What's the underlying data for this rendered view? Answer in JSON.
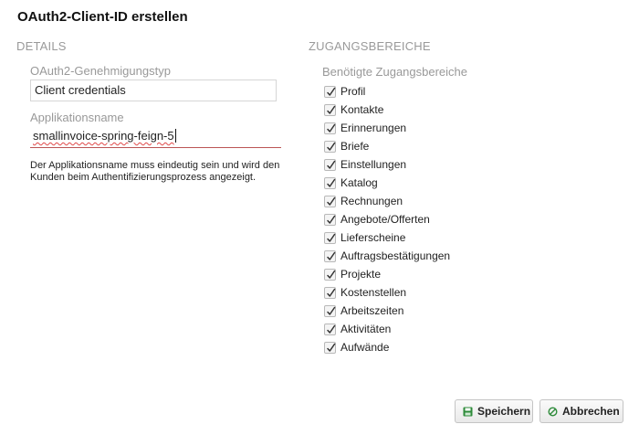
{
  "dialog": {
    "title": "OAuth2-Client-ID erstellen"
  },
  "details": {
    "heading": "DETAILS",
    "grant_type_label": "OAuth2-Genehmigungstyp",
    "grant_type_value": "Client credentials",
    "app_name_label": "Applikationsname",
    "app_name_value": "smallinvoice-spring-feign-5",
    "help_text": "Der Applikationsname muss eindeutig sein und wird den Kunden beim Authentifizierungsprozess angezeigt."
  },
  "scopes": {
    "heading": "ZUGANGSBEREICHE",
    "required_label": "Benötigte Zugangsbereiche",
    "items": [
      {
        "label": "Profil",
        "checked": true
      },
      {
        "label": "Kontakte",
        "checked": true
      },
      {
        "label": "Erinnerungen",
        "checked": true
      },
      {
        "label": "Briefe",
        "checked": true
      },
      {
        "label": "Einstellungen",
        "checked": true
      },
      {
        "label": "Katalog",
        "checked": true
      },
      {
        "label": "Rechnungen",
        "checked": true
      },
      {
        "label": "Angebote/Offerten",
        "checked": true
      },
      {
        "label": "Lieferscheine",
        "checked": true
      },
      {
        "label": "Auftragsbestätigungen",
        "checked": true
      },
      {
        "label": "Projekte",
        "checked": true
      },
      {
        "label": "Kostenstellen",
        "checked": true
      },
      {
        "label": "Arbeitszeiten",
        "checked": true
      },
      {
        "label": "Aktivitäten",
        "checked": true
      },
      {
        "label": "Aufwände",
        "checked": true
      }
    ]
  },
  "buttons": {
    "save_label": "Speichern",
    "save_icon": "save-icon",
    "save_icon_color": "#2e8b3a",
    "cancel_label": "Abbrechen",
    "cancel_icon": "cancel-icon",
    "cancel_icon_color": "#2e8b3a"
  }
}
